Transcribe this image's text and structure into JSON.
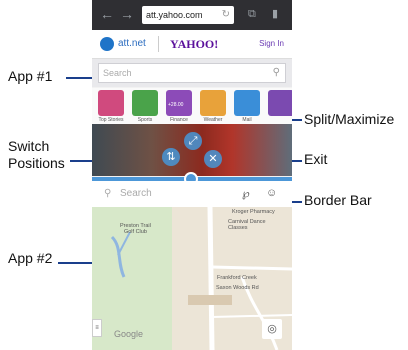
{
  "callouts": {
    "app1": "App #1",
    "switch_line1": "Switch",
    "switch_line2": "Positions",
    "app2": "App #2",
    "split": "Split/Maximize",
    "exit": "Exit",
    "border": "Border Bar"
  },
  "browser": {
    "url": "att.yahoo.com"
  },
  "app1": {
    "att_label": "att.net",
    "yahoo_logo": "YAHOO!",
    "signin": "Sign In",
    "search_placeholder": "Search",
    "tiles": [
      {
        "label": "Top Stories",
        "color": "#d04a7e"
      },
      {
        "label": "Sports",
        "color": "#4aa34a"
      },
      {
        "label": "Finance",
        "color": "#8c4bb8"
      },
      {
        "label": "Weather",
        "color": "#e8a23a"
      },
      {
        "label": "Mail",
        "color": "#3a8ed8"
      }
    ],
    "finance_value": "+28.00"
  },
  "app2": {
    "search_placeholder": "Search",
    "labels": {
      "preston": "Preston Trail\nGolf Club",
      "kroger": "Kroger Pharmacy",
      "dance": "Carnival Dance\nClasses",
      "frankford": "Frankford Creek",
      "saxon": "Saxon Woods Rd",
      "google": "Google"
    }
  },
  "colors": {
    "callout_line": "#1a3f8c",
    "border_bar": "#4c97d8"
  }
}
